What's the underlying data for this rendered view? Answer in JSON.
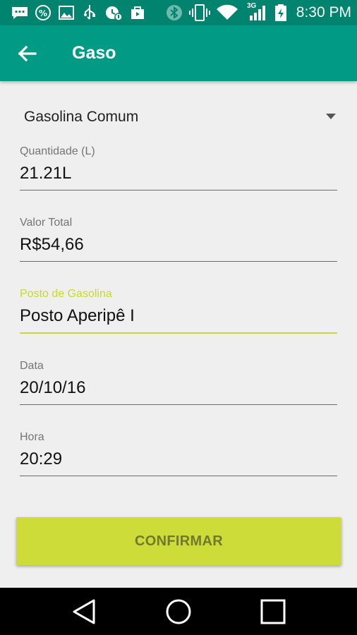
{
  "status_bar": {
    "time": "8:30 PM",
    "network_label": "3G",
    "icons": [
      "message-icon",
      "percent-icon",
      "image-icon",
      "usb-icon",
      "alarm-icon",
      "store-icon",
      "bluetooth-icon",
      "vibrate-icon",
      "wifi-icon",
      "signal-icon",
      "battery-charging-icon"
    ]
  },
  "app_bar": {
    "title": "Gaso",
    "back_icon": "arrow-back-icon"
  },
  "form": {
    "fuel_type": "Gasolina Comum",
    "quantity": {
      "label": "Quantidade (L)",
      "value": "21.21L"
    },
    "total_value": {
      "label": "Valor Total",
      "value": "R$54,66"
    },
    "station": {
      "label": "Posto de Gasolina",
      "value": "Posto Aperipê I"
    },
    "date": {
      "label": "Data",
      "value": "20/10/16"
    },
    "time": {
      "label": "Hora",
      "value": "20:29"
    }
  },
  "confirm_button": {
    "label": "CONFIRMAR"
  },
  "nav_bar": {
    "icons": [
      "back-triangle-icon",
      "home-circle-icon",
      "recents-square-icon"
    ]
  },
  "colors": {
    "status_bar": "#00836f",
    "app_bar": "#009a85",
    "accent": "#cddc39",
    "focused_label": "#c8d82d",
    "background": "#efefef"
  }
}
